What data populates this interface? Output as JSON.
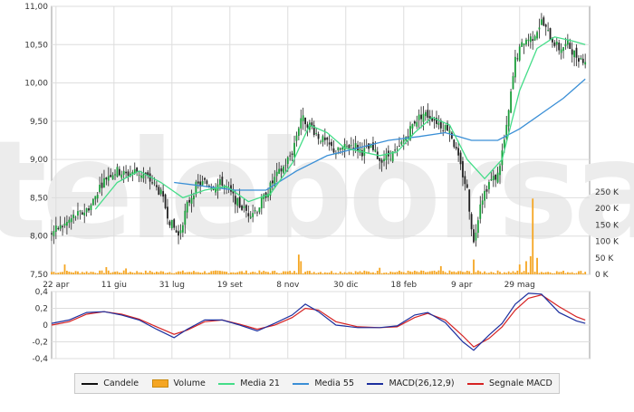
{
  "chart_data": [
    {
      "panel": "price",
      "type": "candlestick",
      "ylim": [
        7.5,
        11.0
      ],
      "yticks": [
        "11,00",
        "10,50",
        "10,00",
        "9,50",
        "9,00",
        "8,50",
        "8,00",
        "7,50"
      ],
      "xticks": [
        "22 apr",
        "11 giu",
        "31 lug",
        "19 set",
        "8 nov",
        "30 dic",
        "18 feb",
        "9 apr",
        "29 mag"
      ],
      "watermark": "teleborsa",
      "close_series": [
        {
          "t": 0,
          "v": 8.05
        },
        {
          "t": 3,
          "v": 8.1
        },
        {
          "t": 6,
          "v": 8.15
        },
        {
          "t": 10,
          "v": 8.25
        },
        {
          "t": 14,
          "v": 8.3
        },
        {
          "t": 18,
          "v": 8.4
        },
        {
          "t": 22,
          "v": 8.65
        },
        {
          "t": 26,
          "v": 8.8
        },
        {
          "t": 30,
          "v": 8.85
        },
        {
          "t": 34,
          "v": 8.8
        },
        {
          "t": 38,
          "v": 8.85
        },
        {
          "t": 42,
          "v": 8.8
        },
        {
          "t": 46,
          "v": 8.7
        },
        {
          "t": 50,
          "v": 8.55
        },
        {
          "t": 54,
          "v": 8.2
        },
        {
          "t": 58,
          "v": 8.0
        },
        {
          "t": 62,
          "v": 8.4
        },
        {
          "t": 66,
          "v": 8.65
        },
        {
          "t": 70,
          "v": 8.7
        },
        {
          "t": 74,
          "v": 8.65
        },
        {
          "t": 78,
          "v": 8.7
        },
        {
          "t": 82,
          "v": 8.55
        },
        {
          "t": 86,
          "v": 8.4
        },
        {
          "t": 90,
          "v": 8.3
        },
        {
          "t": 94,
          "v": 8.35
        },
        {
          "t": 98,
          "v": 8.55
        },
        {
          "t": 102,
          "v": 8.75
        },
        {
          "t": 106,
          "v": 8.9
        },
        {
          "t": 110,
          "v": 9.1
        },
        {
          "t": 114,
          "v": 9.55
        },
        {
          "t": 118,
          "v": 9.45
        },
        {
          "t": 122,
          "v": 9.3
        },
        {
          "t": 126,
          "v": 9.2
        },
        {
          "t": 130,
          "v": 9.1
        },
        {
          "t": 134,
          "v": 9.15
        },
        {
          "t": 138,
          "v": 9.2
        },
        {
          "t": 142,
          "v": 9.1
        },
        {
          "t": 146,
          "v": 9.15
        },
        {
          "t": 150,
          "v": 9.0
        },
        {
          "t": 154,
          "v": 9.05
        },
        {
          "t": 158,
          "v": 9.1
        },
        {
          "t": 162,
          "v": 9.3
        },
        {
          "t": 166,
          "v": 9.5
        },
        {
          "t": 170,
          "v": 9.6
        },
        {
          "t": 174,
          "v": 9.55
        },
        {
          "t": 178,
          "v": 9.45
        },
        {
          "t": 182,
          "v": 9.4
        },
        {
          "t": 186,
          "v": 9.0
        },
        {
          "t": 190,
          "v": 8.6
        },
        {
          "t": 193,
          "v": 7.9
        },
        {
          "t": 196,
          "v": 8.45
        },
        {
          "t": 200,
          "v": 8.7
        },
        {
          "t": 204,
          "v": 8.8
        },
        {
          "t": 208,
          "v": 9.4
        },
        {
          "t": 212,
          "v": 10.3
        },
        {
          "t": 216,
          "v": 10.55
        },
        {
          "t": 220,
          "v": 10.6
        },
        {
          "t": 224,
          "v": 10.8
        },
        {
          "t": 228,
          "v": 10.6
        },
        {
          "t": 232,
          "v": 10.45
        },
        {
          "t": 236,
          "v": 10.5
        },
        {
          "t": 240,
          "v": 10.35
        },
        {
          "t": 244,
          "v": 10.3
        }
      ],
      "ma21": [
        {
          "t": 20,
          "v": 8.35
        },
        {
          "t": 30,
          "v": 8.7
        },
        {
          "t": 40,
          "v": 8.85
        },
        {
          "t": 50,
          "v": 8.7
        },
        {
          "t": 60,
          "v": 8.5
        },
        {
          "t": 70,
          "v": 8.6
        },
        {
          "t": 80,
          "v": 8.65
        },
        {
          "t": 90,
          "v": 8.45
        },
        {
          "t": 100,
          "v": 8.55
        },
        {
          "t": 110,
          "v": 8.95
        },
        {
          "t": 118,
          "v": 9.45
        },
        {
          "t": 126,
          "v": 9.35
        },
        {
          "t": 134,
          "v": 9.15
        },
        {
          "t": 142,
          "v": 9.1
        },
        {
          "t": 150,
          "v": 9.05
        },
        {
          "t": 158,
          "v": 9.1
        },
        {
          "t": 166,
          "v": 9.35
        },
        {
          "t": 174,
          "v": 9.55
        },
        {
          "t": 182,
          "v": 9.45
        },
        {
          "t": 190,
          "v": 9.0
        },
        {
          "t": 198,
          "v": 8.75
        },
        {
          "t": 206,
          "v": 9.0
        },
        {
          "t": 214,
          "v": 9.9
        },
        {
          "t": 222,
          "v": 10.45
        },
        {
          "t": 230,
          "v": 10.6
        },
        {
          "t": 238,
          "v": 10.55
        },
        {
          "t": 244,
          "v": 10.5
        }
      ],
      "ma55": [
        {
          "t": 56,
          "v": 8.7
        },
        {
          "t": 70,
          "v": 8.65
        },
        {
          "t": 84,
          "v": 8.6
        },
        {
          "t": 98,
          "v": 8.6
        },
        {
          "t": 112,
          "v": 8.85
        },
        {
          "t": 126,
          "v": 9.05
        },
        {
          "t": 140,
          "v": 9.15
        },
        {
          "t": 154,
          "v": 9.25
        },
        {
          "t": 168,
          "v": 9.3
        },
        {
          "t": 180,
          "v": 9.35
        },
        {
          "t": 192,
          "v": 9.25
        },
        {
          "t": 204,
          "v": 9.25
        },
        {
          "t": 214,
          "v": 9.4
        },
        {
          "t": 224,
          "v": 9.6
        },
        {
          "t": 234,
          "v": 9.8
        },
        {
          "t": 244,
          "v": 10.05
        }
      ],
      "volume_axis": {
        "ylim": [
          0,
          250000
        ],
        "ticks": [
          "250 K",
          "200 K",
          "150 K",
          "100 K",
          "50 K",
          "0 K"
        ]
      },
      "volume_spikes": [
        {
          "t": 6,
          "v": 30000
        },
        {
          "t": 25,
          "v": 22000
        },
        {
          "t": 34,
          "v": 18000
        },
        {
          "t": 113,
          "v": 60000
        },
        {
          "t": 114,
          "v": 40000
        },
        {
          "t": 150,
          "v": 20000
        },
        {
          "t": 178,
          "v": 25000
        },
        {
          "t": 193,
          "v": 45000
        },
        {
          "t": 214,
          "v": 30000
        },
        {
          "t": 217,
          "v": 40000
        },
        {
          "t": 219,
          "v": 55000
        },
        {
          "t": 220,
          "v": 230000
        },
        {
          "t": 222,
          "v": 50000
        }
      ],
      "colors": {
        "volume": "#f5a623",
        "ma21": "#44dd88",
        "ma55": "#3a8fd6",
        "bull": "#1a9e3a",
        "bear": "#222222"
      }
    },
    {
      "panel": "macd",
      "type": "line",
      "ylim": [
        -0.4,
        0.4
      ],
      "yticks": [
        "0,4",
        "0,2",
        "0",
        "-0,2",
        "-0,4"
      ],
      "series": [
        {
          "name": "MACD(26,12,9)",
          "color": "#1c2f9e",
          "points": [
            {
              "t": 0,
              "v": 0.02
            },
            {
              "t": 8,
              "v": 0.06
            },
            {
              "t": 16,
              "v": 0.15
            },
            {
              "t": 24,
              "v": 0.16
            },
            {
              "t": 32,
              "v": 0.12
            },
            {
              "t": 40,
              "v": 0.06
            },
            {
              "t": 48,
              "v": -0.05
            },
            {
              "t": 56,
              "v": -0.15
            },
            {
              "t": 62,
              "v": -0.05
            },
            {
              "t": 70,
              "v": 0.06
            },
            {
              "t": 78,
              "v": 0.06
            },
            {
              "t": 86,
              "v": 0.0
            },
            {
              "t": 94,
              "v": -0.07
            },
            {
              "t": 102,
              "v": 0.02
            },
            {
              "t": 110,
              "v": 0.12
            },
            {
              "t": 116,
              "v": 0.25
            },
            {
              "t": 122,
              "v": 0.16
            },
            {
              "t": 130,
              "v": 0.0
            },
            {
              "t": 140,
              "v": -0.03
            },
            {
              "t": 150,
              "v": -0.03
            },
            {
              "t": 158,
              "v": -0.01
            },
            {
              "t": 166,
              "v": 0.12
            },
            {
              "t": 172,
              "v": 0.15
            },
            {
              "t": 180,
              "v": 0.03
            },
            {
              "t": 188,
              "v": -0.2
            },
            {
              "t": 193,
              "v": -0.3
            },
            {
              "t": 200,
              "v": -0.12
            },
            {
              "t": 206,
              "v": 0.02
            },
            {
              "t": 212,
              "v": 0.25
            },
            {
              "t": 218,
              "v": 0.38
            },
            {
              "t": 224,
              "v": 0.37
            },
            {
              "t": 232,
              "v": 0.15
            },
            {
              "t": 240,
              "v": 0.05
            },
            {
              "t": 244,
              "v": 0.02
            }
          ]
        },
        {
          "name": "Segnale MACD",
          "color": "#d62222",
          "points": [
            {
              "t": 0,
              "v": 0.0
            },
            {
              "t": 8,
              "v": 0.04
            },
            {
              "t": 16,
              "v": 0.13
            },
            {
              "t": 24,
              "v": 0.16
            },
            {
              "t": 32,
              "v": 0.13
            },
            {
              "t": 40,
              "v": 0.07
            },
            {
              "t": 48,
              "v": -0.02
            },
            {
              "t": 56,
              "v": -0.11
            },
            {
              "t": 62,
              "v": -0.06
            },
            {
              "t": 70,
              "v": 0.04
            },
            {
              "t": 78,
              "v": 0.06
            },
            {
              "t": 86,
              "v": 0.01
            },
            {
              "t": 94,
              "v": -0.05
            },
            {
              "t": 102,
              "v": 0.0
            },
            {
              "t": 110,
              "v": 0.09
            },
            {
              "t": 116,
              "v": 0.2
            },
            {
              "t": 122,
              "v": 0.18
            },
            {
              "t": 130,
              "v": 0.04
            },
            {
              "t": 140,
              "v": -0.02
            },
            {
              "t": 150,
              "v": -0.03
            },
            {
              "t": 158,
              "v": -0.02
            },
            {
              "t": 166,
              "v": 0.09
            },
            {
              "t": 172,
              "v": 0.14
            },
            {
              "t": 180,
              "v": 0.06
            },
            {
              "t": 188,
              "v": -0.13
            },
            {
              "t": 193,
              "v": -0.26
            },
            {
              "t": 200,
              "v": -0.16
            },
            {
              "t": 206,
              "v": -0.02
            },
            {
              "t": 212,
              "v": 0.18
            },
            {
              "t": 218,
              "v": 0.32
            },
            {
              "t": 224,
              "v": 0.36
            },
            {
              "t": 232,
              "v": 0.22
            },
            {
              "t": 240,
              "v": 0.1
            },
            {
              "t": 244,
              "v": 0.06
            }
          ]
        }
      ]
    }
  ],
  "legend": [
    {
      "label": "Candele",
      "kind": "line",
      "color": "#111111"
    },
    {
      "label": "Volume",
      "kind": "box",
      "color": "#f5a623"
    },
    {
      "label": "Media 21",
      "kind": "line",
      "color": "#44dd88"
    },
    {
      "label": "Media 55",
      "kind": "line",
      "color": "#3a8fd6"
    },
    {
      "label": "MACD(26,12,9)",
      "kind": "line",
      "color": "#1c2f9e"
    },
    {
      "label": "Segnale MACD",
      "kind": "line",
      "color": "#d62222"
    }
  ]
}
